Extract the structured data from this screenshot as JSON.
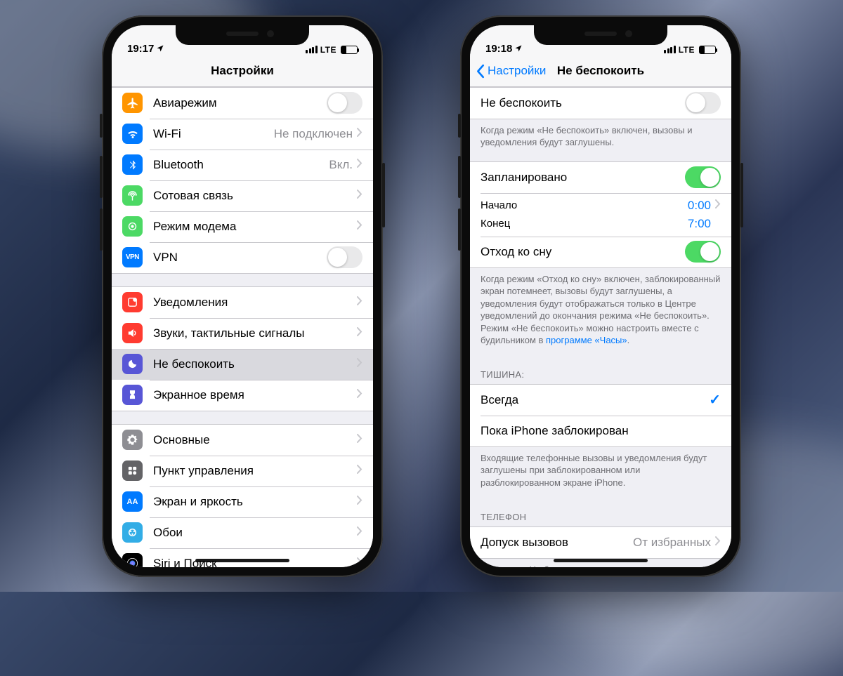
{
  "phone1": {
    "status": {
      "time": "19:17",
      "net": "LTE"
    },
    "title": "Настройки",
    "group1": [
      {
        "label": "Авиарежим",
        "icon": "airplane",
        "color": "ic-orange",
        "control": "toggle-off"
      },
      {
        "label": "Wi-Fi",
        "icon": "wifi",
        "color": "ic-blue",
        "detail": "Не подключен",
        "control": "disclosure"
      },
      {
        "label": "Bluetooth",
        "icon": "bluetooth",
        "color": "ic-blue",
        "detail": "Вкл.",
        "control": "disclosure"
      },
      {
        "label": "Сотовая связь",
        "icon": "cellular",
        "color": "ic-green",
        "control": "disclosure"
      },
      {
        "label": "Режим модема",
        "icon": "hotspot",
        "color": "ic-hotspot",
        "control": "disclosure"
      },
      {
        "label": "VPN",
        "icon": "vpn",
        "color": "ic-vpn",
        "control": "toggle-off"
      }
    ],
    "group2": [
      {
        "label": "Уведомления",
        "icon": "notifications",
        "color": "ic-red",
        "control": "disclosure"
      },
      {
        "label": "Звуки, тактильные сигналы",
        "icon": "sounds",
        "color": "ic-red",
        "control": "disclosure"
      },
      {
        "label": "Не беспокоить",
        "icon": "moon",
        "color": "ic-purple",
        "control": "disclosure",
        "selected": true
      },
      {
        "label": "Экранное время",
        "icon": "screentime",
        "color": "ic-purple",
        "control": "disclosure"
      }
    ],
    "group3": [
      {
        "label": "Основные",
        "icon": "general",
        "color": "ic-gray",
        "control": "disclosure"
      },
      {
        "label": "Пункт управления",
        "icon": "controlcenter",
        "color": "ic-darkgray",
        "control": "disclosure"
      },
      {
        "label": "Экран и яркость",
        "icon": "display",
        "color": "ic-blue",
        "control": "disclosure"
      },
      {
        "label": "Обои",
        "icon": "wallpaper",
        "color": "ic-teal",
        "control": "disclosure"
      },
      {
        "label": "Siri и Поиск",
        "icon": "siri",
        "color": "ic-black",
        "control": "disclosure"
      }
    ]
  },
  "phone2": {
    "status": {
      "time": "19:18",
      "net": "LTE"
    },
    "back": "Настройки",
    "title": "Не беспокоить",
    "dnd_label": "Не беспокоить",
    "dnd_footer": "Когда режим «Не беспокоить» включен, вызовы и уведомления будут заглушены.",
    "scheduled_label": "Запланировано",
    "start_label": "Начало",
    "start_value": "0:00",
    "end_label": "Конец",
    "end_value": "7:00",
    "bedtime_label": "Отход ко сну",
    "bedtime_footer_pre": "Когда режим «Отход ко сну» включен, заблокированный экран потемнеет, вызовы будут заглушены, а уведомления будут отображаться только в Центре уведомлений до окончания режима «Не беспокоить». Режим «Не беспокоить» можно настроить вместе с будильником в ",
    "bedtime_footer_link": "программе «Часы»",
    "bedtime_footer_post": ".",
    "silence_header": "ТИШИНА:",
    "silence_always": "Всегда",
    "silence_locked": "Пока iPhone заблокирован",
    "silence_footer": "Входящие телефонные вызовы и уведомления будут заглушены при заблокированном или разблокированном экране iPhone.",
    "phone_header": "ТЕЛЕФОН",
    "allow_label": "Допуск вызовов",
    "allow_value": "От избранных",
    "allow_footer": "В режиме «Не беспокоить» разрешить входящие телефонные вызовы от своих избранных контактов."
  }
}
